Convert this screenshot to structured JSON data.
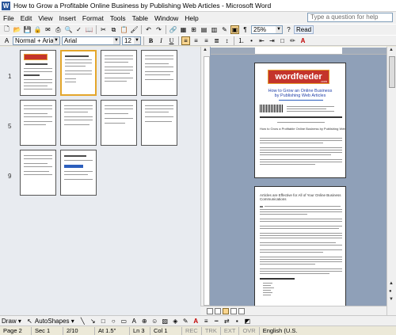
{
  "window": {
    "title": "How to Grow a Profitable Online Business by Publishing Web Articles - Microsoft Word",
    "app_icon": "W"
  },
  "menu": {
    "items": [
      {
        "label": "File",
        "key": "F"
      },
      {
        "label": "Edit",
        "key": "E"
      },
      {
        "label": "View",
        "key": "V"
      },
      {
        "label": "Insert",
        "key": "I"
      },
      {
        "label": "Format",
        "key": "o"
      },
      {
        "label": "Tools",
        "key": "T"
      },
      {
        "label": "Table",
        "key": "a"
      },
      {
        "label": "Window",
        "key": "W"
      },
      {
        "label": "Help",
        "key": "H"
      }
    ],
    "help_placeholder": "Type a question for help"
  },
  "standard_toolbar": {
    "zoom": "25%",
    "read_label": "Read"
  },
  "formatting_toolbar": {
    "style": "Normal + Arial",
    "font": "Arial",
    "size": "12",
    "bold": "B",
    "italic": "I",
    "underline": "U"
  },
  "thumbnails": {
    "row_labels": [
      "1",
      "5",
      "9"
    ]
  },
  "document": {
    "logo_text": "wordfeeder",
    "logo_small": ".com",
    "title_line1": "How to Grow an Online Business",
    "title_line2": "by Publishing Web Articles",
    "section_heading": "How to Grow a Profitable Online Business by Publishing Web Articles",
    "page2_heading": "Articles are Effective for All of Your Online Business Communications"
  },
  "drawing_toolbar": {
    "draw_label": "Draw",
    "autoshapes_label": "AutoShapes"
  },
  "status": {
    "page": "Page 2",
    "sec": "Sec 1",
    "pages": "2/10",
    "at": "At 1.5\"",
    "ln": "Ln 3",
    "col": "Col 1",
    "rec": "REC",
    "trk": "TRK",
    "ext": "EXT",
    "ovr": "OVR",
    "language": "English (U.S."
  }
}
